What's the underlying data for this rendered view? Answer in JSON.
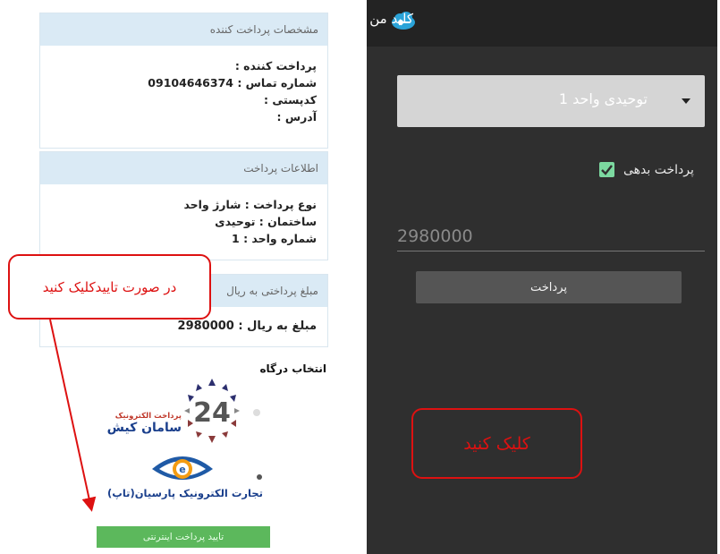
{
  "left_panel": {
    "payer_card": {
      "title": "مشخصات پرداخت کننده",
      "payer_label": "پرداخت کننده :",
      "phone_line": "شماره تماس : 09104646374",
      "postal_label": "کدپستی :",
      "address_label": "آدرس :"
    },
    "payment_card": {
      "title": "اطلاعات پرداخت",
      "type_line": "نوع پرداخت : شارژ واحد",
      "building_line": "ساختمان : توحیدی",
      "unit_line": "شماره واحد : 1"
    },
    "amount_card": {
      "title": "مبلغ پرداختی به ریال",
      "amount_line": "مبلغ به ریال : 2980000"
    },
    "gateway": {
      "title": "انتخاب درگاه",
      "saman_small": "پرداخت الکترونیک",
      "saman_big": "سامان کیش",
      "saman_number": "24",
      "parsian_name": "تجارت الکترونیک پارسیان(تاپ)"
    },
    "confirm_button": "تایید پرداخت اینترنتی"
  },
  "annotations": {
    "note_left": "در صورت تاییدکلیک کنید",
    "note_right": "کلیک کنید",
    "color": "#dd1111"
  },
  "phone": {
    "app_title": "کلید من",
    "spinner_value": "توحیدی واحد 1",
    "checkbox_label": "پرداخت بدهی",
    "checkbox_checked": true,
    "amount_value": "2980000",
    "pay_button": "پرداخت"
  }
}
